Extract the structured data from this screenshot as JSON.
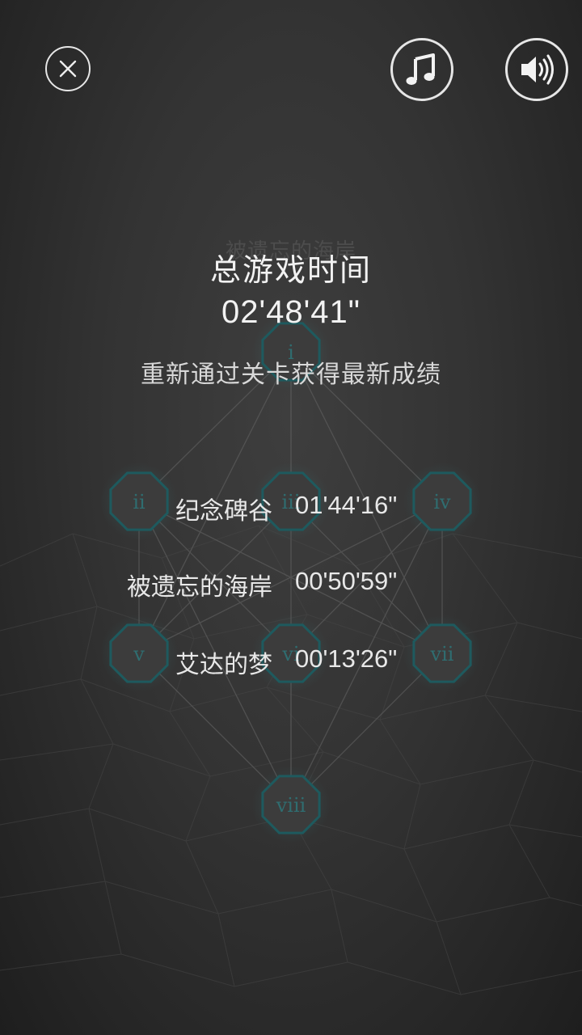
{
  "toolbar": {
    "close_icon": "close-icon",
    "music_icon": "music-note-icon",
    "sound_icon": "speaker-icon"
  },
  "level_map": {
    "chapter_title": "被遗忘的海岸",
    "nodes": [
      "i",
      "ii",
      "iii",
      "iv",
      "v",
      "vi",
      "vii",
      "viii"
    ]
  },
  "summary": {
    "title": "总游戏时间",
    "total_time": "02'48'41\"",
    "hint": "重新通过关卡获得最新成绩"
  },
  "records": [
    {
      "name": "纪念碑谷",
      "time": "01'44'16\""
    },
    {
      "name": "被遗忘的海岸",
      "time": "00'50'59\""
    },
    {
      "name": "艾达的梦",
      "time": "00'13'26\""
    }
  ],
  "colors": {
    "node_fill": "#3c3c3c",
    "node_ring": "#1e5a5e",
    "node_glow": "#2c6f72",
    "text": "#f2f2f2"
  }
}
